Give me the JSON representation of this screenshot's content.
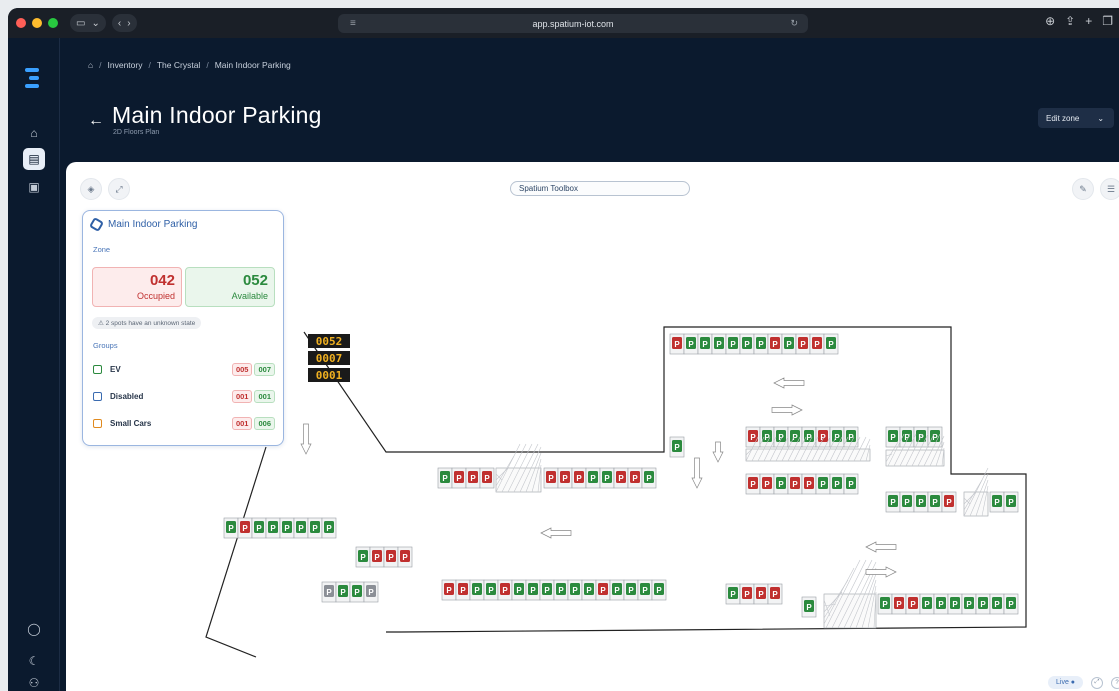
{
  "browser": {
    "url": "app.spatium-iot.com",
    "light_colors": [
      "#ff5f57",
      "#febc2e",
      "#28c840"
    ]
  },
  "sidebar": {
    "icons": [
      "home-icon",
      "document-icon",
      "clipboard-icon",
      "user-icon",
      "moon-icon",
      "users-icon"
    ]
  },
  "breadcrumb": {
    "items": [
      "Inventory",
      "The Crystal",
      "Main Indoor Parking"
    ]
  },
  "header": {
    "title": "Main Indoor Parking",
    "subtitle": "2D Floors Plan",
    "edit_zone_label": "Edit zone"
  },
  "toolbox": {
    "label": "Spatium Toolbox"
  },
  "panel": {
    "title": "Main Indoor Parking",
    "zone_label": "Zone",
    "occupied_value": "042",
    "occupied_label": "Occupied",
    "available_value": "052",
    "available_label": "Available",
    "unknown_text": "2 spots have an unknown state",
    "groups_label": "Groups",
    "groups": [
      {
        "name": "EV",
        "occupied": "005",
        "available": "007",
        "color": "#2b8a3e"
      },
      {
        "name": "Disabled",
        "occupied": "001",
        "available": "001",
        "color": "#3a6bb0"
      },
      {
        "name": "Small Cars",
        "occupied": "001",
        "available": "006",
        "color": "#e08a1e"
      }
    ]
  },
  "displays": [
    "0052",
    "0007",
    "0001"
  ],
  "footer": {
    "live_label": "Live"
  },
  "colors": {
    "occupied": "#c0302f",
    "available": "#2b8a3e",
    "unknown": "#8b8f96",
    "navy": "#0b1a2e"
  }
}
